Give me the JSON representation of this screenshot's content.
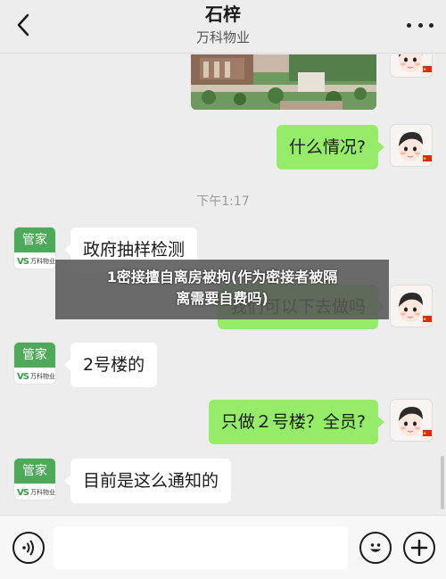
{
  "header": {
    "title": "石梓",
    "subtitle": "万科物业"
  },
  "agent": {
    "badge_label": "管家",
    "logo_text": "VS",
    "company_small": "万科物业"
  },
  "messages": {
    "m1": "什么情况?",
    "time": "下午1:17",
    "m2": "政府抽样检测",
    "m3": "我们可以下去做吗",
    "m4": "2号楼的",
    "m5": "只做２号楼？全员?",
    "m6": "目前是这么通知的"
  },
  "overlay": {
    "line1": "1密接擅自离房被拘(作为密接者被隔",
    "line2": "离需要自费吗)"
  },
  "colors": {
    "my_bubble": "#95ec69",
    "other_bubble": "#ffffff",
    "background": "#ededed",
    "agent_green": "#4caa58"
  },
  "icons": {
    "back": "chevron-left-icon",
    "more": "more-dots-icon",
    "voice": "voice-icon",
    "emoji": "emoji-icon",
    "plus": "plus-icon"
  },
  "input": {
    "value": "",
    "placeholder": ""
  }
}
